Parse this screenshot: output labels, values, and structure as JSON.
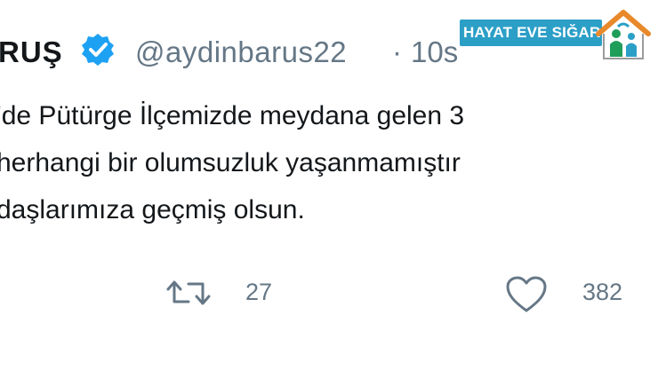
{
  "tweet": {
    "display_name": "RUŞ",
    "handle": "@aydinbarus22",
    "separator": "·",
    "timestamp": "10s",
    "lines": [
      "'de Pütürge İlçemizde meydana gelen 3",
      " herhangi bir olumsuzluk yaşanmamıştır",
      " daşlarımıza geçmiş olsun."
    ],
    "retweet_count": "27",
    "like_count": "382"
  },
  "watermark": {
    "text": "HAYAT EVE SIĞAR"
  },
  "colors": {
    "verified_blue": "#1da1f2",
    "muted_gray": "#657786",
    "watermark_blue": "#2c9fc7",
    "watermark_orange": "#e8892b",
    "watermark_green": "#1f9e5a"
  },
  "icons": {
    "verified": "verified-badge-icon",
    "retweet": "retweet-icon",
    "like": "heart-icon"
  }
}
